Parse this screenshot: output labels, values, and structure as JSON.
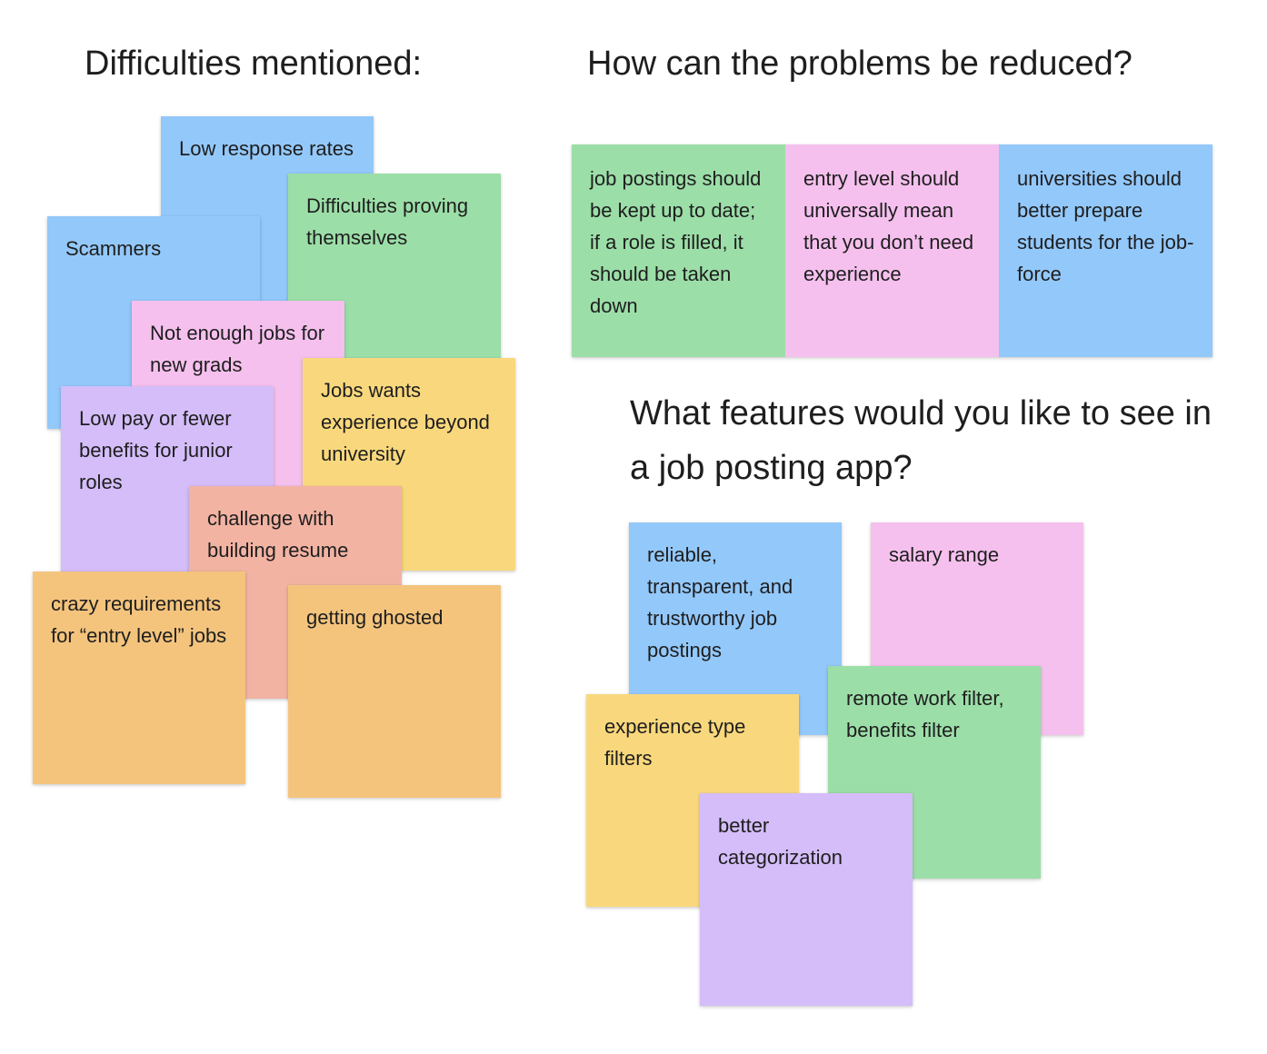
{
  "headings": {
    "difficulties": "Difficulties mentioned:",
    "reduce": "How can the problems be reduced?",
    "features": "What features would you like to see in a job posting app?"
  },
  "difficulties": {
    "low_response": "Low response rates",
    "proving": "Difficulties proving themselves",
    "scammers": "Scammers",
    "not_enough_jobs": "Not enough jobs for new grads",
    "jobs_experience": "Jobs wants experience beyond university",
    "low_pay": "Low pay or fewer benefits for junior roles",
    "resume": "challenge with building resume",
    "crazy_requirements": "crazy requirements for “entry level” jobs",
    "ghosted": "getting ghosted"
  },
  "solutions": [
    "job postings should be kept up to date; if a role is filled, it should be taken down",
    "entry level should universally mean that you don’t need experience",
    "universities should better prepare students for the job-force"
  ],
  "features": {
    "reliable": "reliable, transparent, and trustworthy job postings",
    "salary": "salary range",
    "remote": "remote work filter, benefits filter",
    "experience": "experience type filters",
    "categorization": "better categorization"
  },
  "colors": {
    "blue": "#93c8fa",
    "green": "#9cdea8",
    "pink": "#f5c0ee",
    "yellow": "#f9d87d",
    "purple": "#d4bdf9",
    "salmon": "#f2b3a3",
    "orange": "#f4c47d"
  }
}
